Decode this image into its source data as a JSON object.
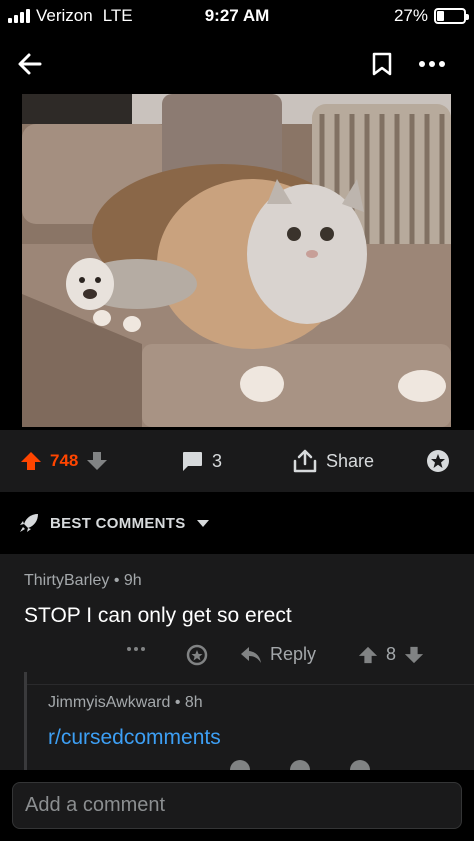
{
  "status_bar": {
    "carrier": "Verizon",
    "network": "LTE",
    "time": "9:27 AM",
    "battery_percent": "27%",
    "battery_level": 0.27
  },
  "nav": {
    "back_icon": "arrow-left-icon",
    "save_icon": "bookmark-icon",
    "more_icon": "ellipsis-icon"
  },
  "post_image": {
    "icon": "photo-icon"
  },
  "post_actions": {
    "score": "748",
    "comments_count": "3",
    "share_label": "Share",
    "accent": "#ff4500"
  },
  "sort": {
    "label": "BEST COMMENTS",
    "icon": "rocket-icon"
  },
  "comments": [
    {
      "author": "ThirtyBarley",
      "age": "9h",
      "body": "STOP I can only get so erect",
      "reply_label": "Reply",
      "score": "8"
    },
    {
      "author": "JimmyisAwkward",
      "age": "8h",
      "body": "r/cursedcomments"
    }
  ],
  "composer": {
    "placeholder": "Add a comment"
  },
  "colors": {
    "background": "#000000",
    "surface": "#1a1a1b",
    "link": "#3d9ff4",
    "upvote": "#ff4500"
  }
}
